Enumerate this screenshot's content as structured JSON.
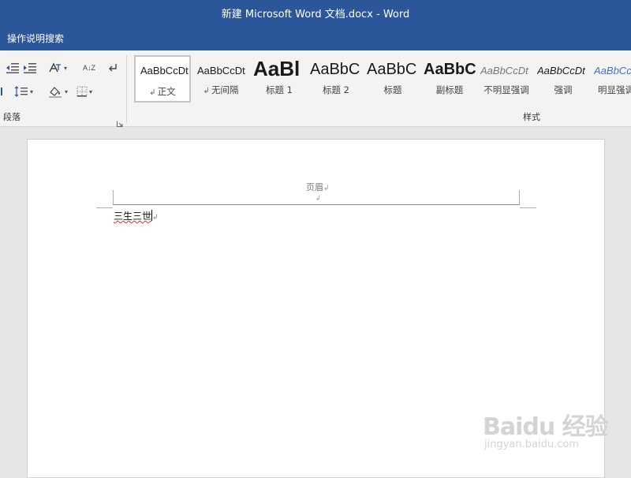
{
  "window": {
    "title": "新建 Microsoft Word 文档.docx  -  Word"
  },
  "tell_me": {
    "label": "操作说明搜索"
  },
  "ribbon": {
    "paragraph_group_label": "段落",
    "styles_group_label": "样式",
    "paragraph_controls": [
      {
        "name": "decrease-indent-icon",
        "interactable": true
      },
      {
        "name": "increase-indent-icon",
        "interactable": true
      },
      {
        "name": "asian-layout-icon",
        "interactable": true
      },
      {
        "name": "sort-icon",
        "interactable": true
      },
      {
        "name": "show-formatting-marks-icon",
        "interactable": true
      },
      {
        "name": "line-spacing-icon",
        "interactable": true
      },
      {
        "name": "shading-icon",
        "interactable": true
      },
      {
        "name": "borders-icon",
        "interactable": true
      }
    ],
    "sort_glyph": "A↓Z",
    "styles": [
      {
        "sample": "AaBbCcDt",
        "name": "正文",
        "selected": true,
        "para_mark": "↲"
      },
      {
        "sample": "AaBbCcDt",
        "name": "无间隔",
        "selected": false,
        "para_mark": "↲"
      },
      {
        "sample": "AaBl",
        "name": "标题 1",
        "selected": false
      },
      {
        "sample": "AaBbC",
        "name": "标题 2",
        "selected": false
      },
      {
        "sample": "AaBbC",
        "name": "标题",
        "selected": false
      },
      {
        "sample": "AaBbC",
        "name": "副标题",
        "selected": false
      },
      {
        "sample": "AaBbCcDt",
        "name": "不明显强调",
        "selected": false
      },
      {
        "sample": "AaBbCcDt",
        "name": "强调",
        "selected": false
      },
      {
        "sample": "AaBbCcDt",
        "name": "明显强调",
        "selected": false
      }
    ]
  },
  "document": {
    "header_label": "页眉",
    "header_para_mark": "↲",
    "empty_header_mark": "↲",
    "body_text": "三生三世",
    "body_para_mark": "↲"
  },
  "watermark": {
    "logo": "Baidu 经验",
    "url": "jingyan.baidu.com"
  },
  "colors": {
    "title_bar": "#2b579a",
    "ribbon": "#f3f3f3",
    "canvas": "#e6e6e6",
    "spell_error": "#d13438",
    "emphasis_blue": "#4472c4"
  }
}
